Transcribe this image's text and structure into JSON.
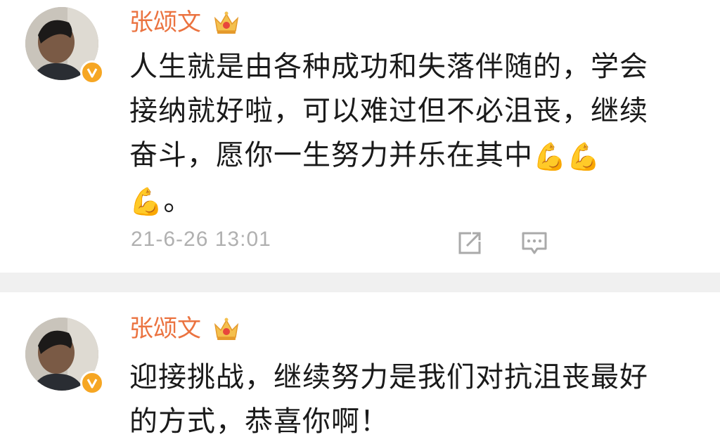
{
  "comments": [
    {
      "author": "张颂文",
      "lines": [
        "人生就是由各种成功和失落伴随的，学会",
        "接纳就好啦，可以难过但不必沮丧，继续",
        "奋斗，愿你一生努力并乐在其中"
      ],
      "end_line": "。",
      "emoji": "💪",
      "timestamp": "21-6-26 13:01",
      "icons": [
        "share-icon",
        "comment-icon"
      ]
    },
    {
      "author": "张颂文",
      "lines": [
        "迎接挑战，继续努力是我们对抗沮丧最好",
        "的方式，恭喜你啊！"
      ]
    }
  ],
  "colors": {
    "author_name": "#eb7340",
    "verified_badge": "#f6a623",
    "timestamp": "#b0b0b0",
    "divider": "#f0f0f0"
  }
}
